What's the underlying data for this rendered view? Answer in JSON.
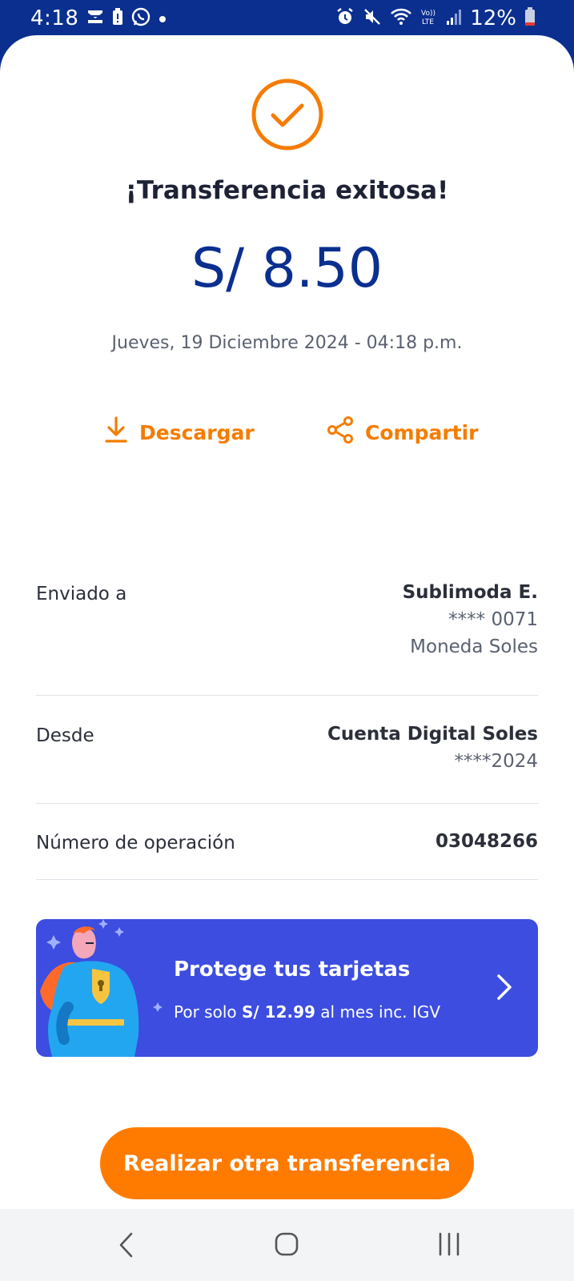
{
  "status_bar": {
    "time": "4:18",
    "battery": "12%",
    "left_icons": [
      "mail-x-icon",
      "battery-alert-icon",
      "whatsapp-icon",
      "dot-icon"
    ],
    "right_icons": [
      "alarm-icon",
      "mute-icon",
      "wifi-icon",
      "volte-icon",
      "signal-icon",
      "battery-icon"
    ]
  },
  "success": {
    "icon": "check-circle-icon",
    "title": "¡Transferencia exitosa!",
    "amount": "S/ 8.50",
    "datetime": "Jueves, 19 Diciembre 2024 - 04:18 p.m."
  },
  "actions": {
    "download_label": "Descargar",
    "share_label": "Compartir"
  },
  "details": {
    "sent_to": {
      "label": "Enviado a",
      "name": "Sublimoda E.",
      "account": "**** 0071",
      "currency": "Moneda Soles"
    },
    "from": {
      "label": "Desde",
      "account_name": "Cuenta Digital Soles",
      "account": "****2024"
    },
    "operation": {
      "label": "Número de operación",
      "number": "03048266"
    }
  },
  "promo": {
    "title": "Protege tus tarjetas",
    "sub_prefix": "Por solo ",
    "sub_price": "S/ 12.99",
    "sub_suffix": " al mes inc. IGV"
  },
  "cta": {
    "label": "Realizar otra transferencia"
  },
  "colors": {
    "brand_blue": "#0a2f8f",
    "accent_orange": "#f57c00",
    "cta_orange": "#ff7b00",
    "promo_blue": "#3c4de0"
  }
}
